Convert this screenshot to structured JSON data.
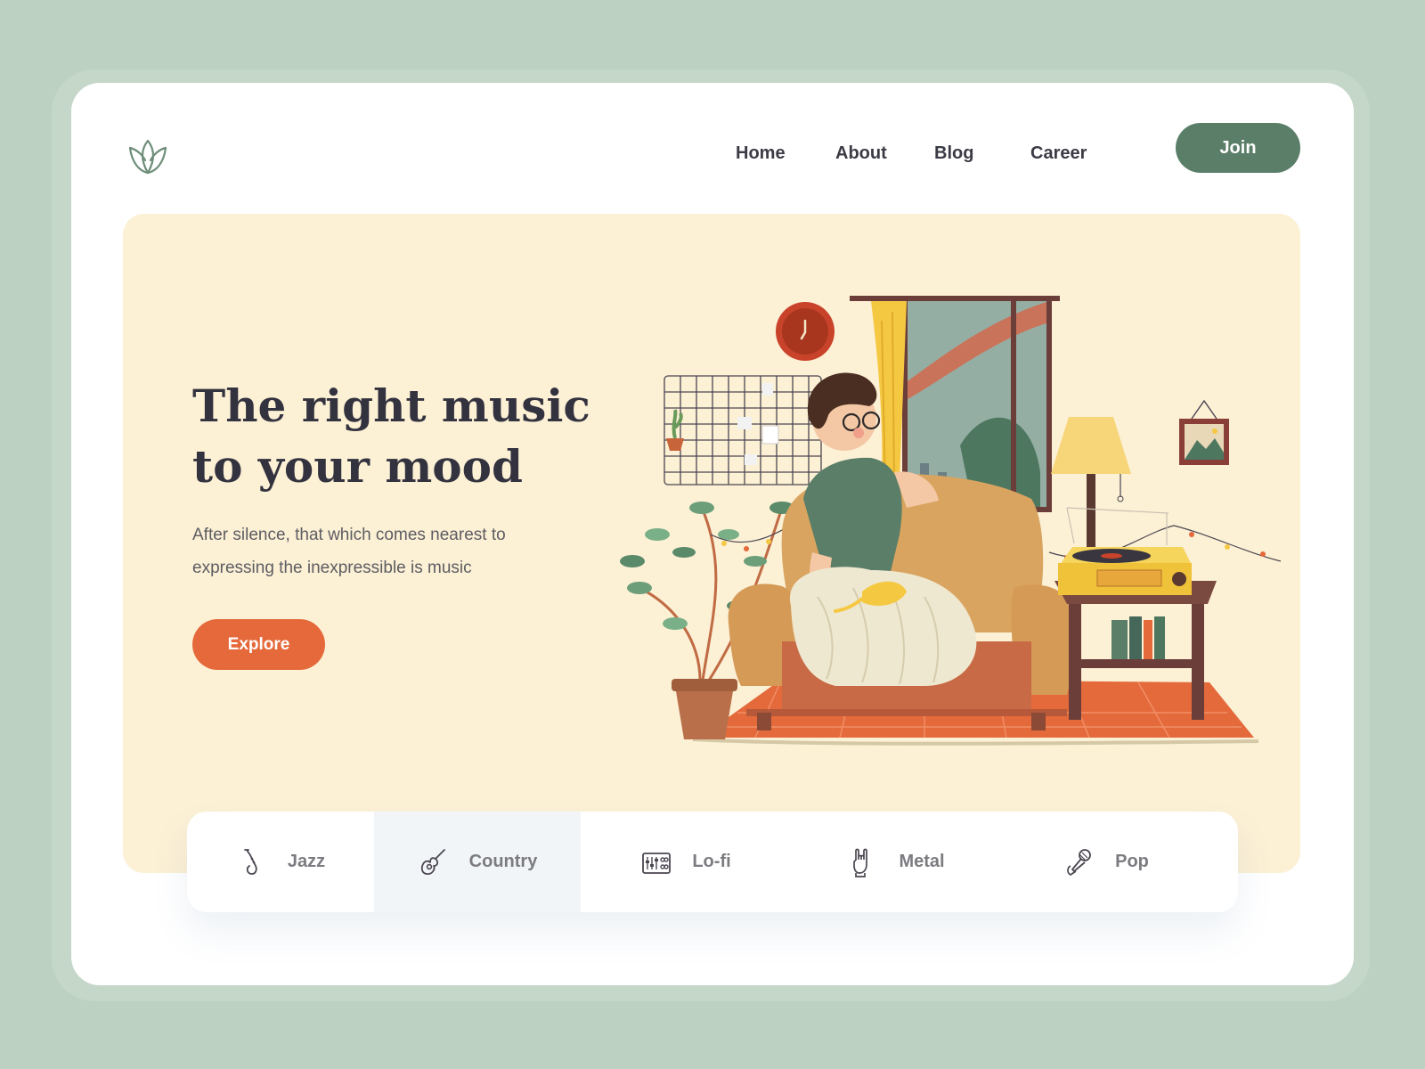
{
  "logo": {
    "icon": "lotus-icon"
  },
  "nav": {
    "items": [
      {
        "label": "Home"
      },
      {
        "label": "About"
      },
      {
        "label": "Blog"
      },
      {
        "label": "Career"
      }
    ],
    "join_label": "Join"
  },
  "hero": {
    "title_line1": "The right music",
    "title_line2": "to your mood",
    "subtitle_line1": "After silence, that which comes nearest to",
    "subtitle_line2": "expressing the inexpressible is music",
    "cta_label": "Explore"
  },
  "genres": [
    {
      "label": "Jazz",
      "icon": "saxophone-icon",
      "active": false
    },
    {
      "label": "Country",
      "icon": "guitar-icon",
      "active": true
    },
    {
      "label": "Lo-fi",
      "icon": "mixer-icon",
      "active": false
    },
    {
      "label": "Metal",
      "icon": "rock-hand-icon",
      "active": false
    },
    {
      "label": "Pop",
      "icon": "microphone-icon",
      "active": false
    }
  ],
  "colors": {
    "background": "#bcd1c1",
    "primary_green": "#5a7e68",
    "accent_orange": "#e5693a",
    "hero_bg": "#fcf0d5",
    "text_dark": "#33323f"
  }
}
